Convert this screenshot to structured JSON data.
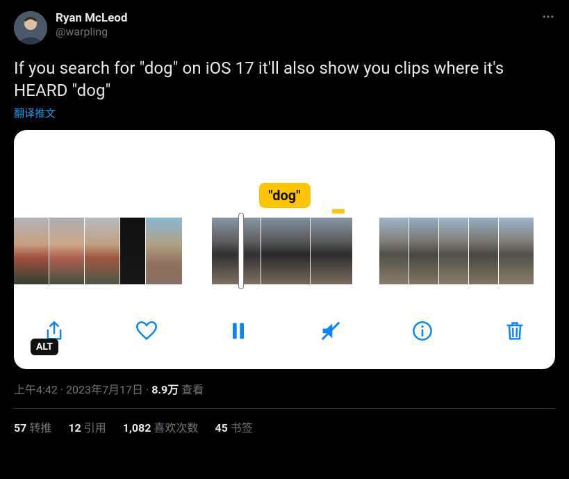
{
  "user": {
    "display_name": "Ryan McLeod",
    "handle": "@warpling"
  },
  "tweet_text": "If you search for \"dog\" on iOS 17 it'll also show you clips where it's HEARD \"dog\"",
  "translate_label": "翻译推文",
  "media": {
    "search_term": "\"dog\"",
    "alt_badge": "ALT"
  },
  "timestamp": "上午4:42",
  "date": "2023年7月17日",
  "views_count": "8.9万",
  "views_label": "查看",
  "stats": {
    "retweets_count": "57",
    "retweets_label": "转推",
    "quotes_count": "12",
    "quotes_label": "引用",
    "likes_count": "1,082",
    "likes_label": "喜欢次数",
    "bookmarks_count": "45",
    "bookmarks_label": "书签"
  }
}
